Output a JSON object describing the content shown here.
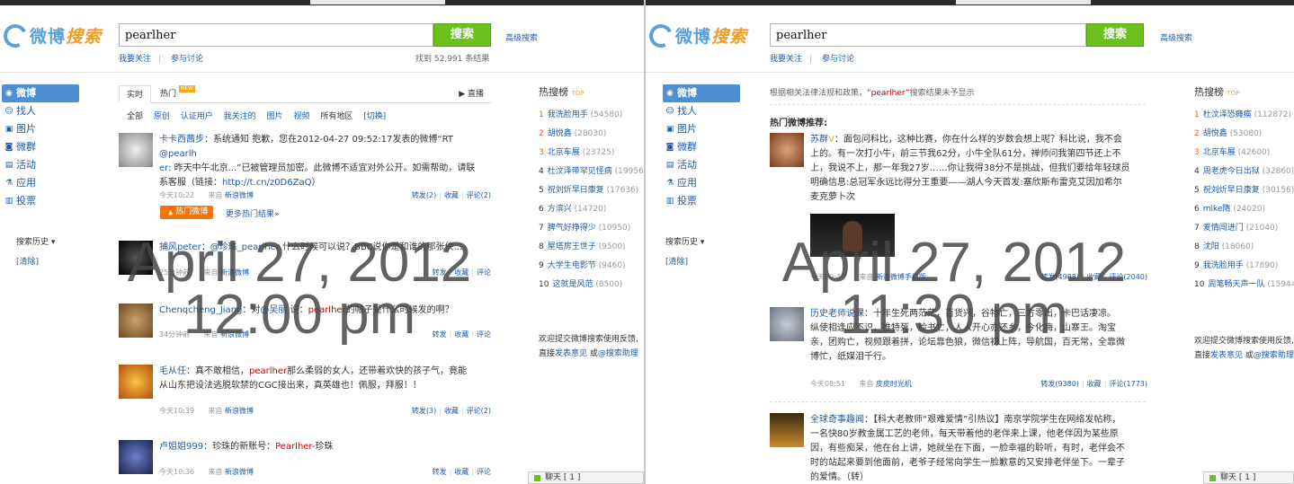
{
  "brand": {
    "logo_main": "微博",
    "logo_accent": "搜索"
  },
  "search": {
    "query": "pearlher",
    "button": "搜索",
    "advanced": "高级搜索",
    "follow": "我要关注",
    "discuss": "参与讨论"
  },
  "sidebar": {
    "items": [
      {
        "label": "微博",
        "icon": "weibo-icon"
      },
      {
        "label": "找人",
        "icon": "person-icon"
      },
      {
        "label": "图片",
        "icon": "image-icon"
      },
      {
        "label": "微群",
        "icon": "group-icon"
      },
      {
        "label": "活动",
        "icon": "event-icon"
      },
      {
        "label": "应用",
        "icon": "app-icon"
      },
      {
        "label": "投票",
        "icon": "vote-icon"
      }
    ],
    "history": "搜索历史 ▾",
    "clear": "[清除]"
  },
  "hot_rank": {
    "title": "热搜榜",
    "title_tag": "TOP"
  },
  "feedback": {
    "line1": "欢迎提交微博搜索使用反馈,",
    "line2_prefix": "直接",
    "line2_link1": "发表意见",
    "line2_mid": " 或",
    "line2_link2": "@搜索助理"
  },
  "chat": "聊天 [ 1 ]",
  "left": {
    "result_count": "找到 52,991 条结果",
    "tabs": {
      "realtime": "实时",
      "hot": "热门",
      "hot_badge": "NEW",
      "live": "直播"
    },
    "filters": [
      "全部",
      "原创",
      "认证用户",
      "我关注的",
      "图片",
      "视频",
      "所有地区",
      "[切换]"
    ],
    "feed": [
      {
        "user": "卡卡西茜步",
        "text1": "：系统通知 抱歉，您在2012-04-27 09:52:17发表的微博“RT ",
        "mention": "@pearlh",
        "text2": "er",
        "text3": ": 昨天中午北京...”已被管理员加密。此微博不适宜对外公开。如需帮助，请联",
        "text4": "系客服（链接：",
        "link": "http://t.cn/z0D6ZaQ",
        "text5": "）",
        "time": "今天10:22",
        "source_prefix": "来自 ",
        "source": "新浪微博",
        "acts": [
          "转发(2)",
          "收藏",
          "评论(2)"
        ]
      },
      {
        "user": "捕风peter",
        "text1": "：",
        "mention": "@珍珠_pearlher",
        "text2": " 什么时候可以说？BBC说你是和谁的那张侠...",
        "time": "25分钟前",
        "source_prefix": "来自 ",
        "source": "新浪微博",
        "acts": [
          "转发",
          "收藏",
          "评论"
        ]
      },
      {
        "user": "Chenqcheng_Jiang",
        "text1": "：对",
        "mention": "@吴丽",
        "text2": " 说：",
        "kw": "pearlher",
        "text3": "的帖子是什么时候发的啊？",
        "time": "34分钟前",
        "source_prefix": "来自 ",
        "source": "新浪微博",
        "acts": [
          "转发",
          "收藏",
          "评论"
        ]
      },
      {
        "user": "毛从任",
        "text1": "：真不敢相信，",
        "kw": "pearlher",
        "text2": "那么柔弱的女人，还带着欢快的孩子气，竟能",
        "text3": "从山东把设法逃脱软禁的CGC接出来，真英雄也！佩服，拜服！！",
        "time": "今天10:39",
        "source_prefix": "来自 ",
        "source": "新浪微博",
        "acts": [
          "转发(3)",
          "收藏",
          "评论(2)"
        ]
      },
      {
        "user": "卢姐姐999",
        "text1": "：珍珠的新账号：",
        "kw": "Pearlher",
        "text2": "-珍珠",
        "time": "今天10:36",
        "source_prefix": "来自 ",
        "source": "新浪微博",
        "acts": [
          "转发",
          "收藏",
          "评论"
        ]
      }
    ],
    "hot_button": "热门微博",
    "more_hot": "更多热门结果»",
    "rank": [
      {
        "n": "1",
        "name": "我洗脸用手",
        "count": "(54580)"
      },
      {
        "n": "2",
        "name": "胡悦鑫",
        "count": "(28030)"
      },
      {
        "n": "3",
        "name": "北京车展",
        "count": "(23725)"
      },
      {
        "n": "4",
        "name": "杜汶泽带罕见怪病",
        "count": "(19956)"
      },
      {
        "n": "5",
        "name": "祝刘炘早日康复",
        "count": "(17636)"
      },
      {
        "n": "6",
        "name": "方滨兴",
        "count": "(14720)"
      },
      {
        "n": "7",
        "name": "脾气好挣得少",
        "count": "(10950)"
      },
      {
        "n": "8",
        "name": "屋塔房王世子",
        "count": "(9500)"
      },
      {
        "n": "9",
        "name": "大学生电影节",
        "count": "(9460)"
      },
      {
        "n": "10",
        "name": "这就是风范",
        "count": "(8500)"
      }
    ],
    "overlay1": "April 27, 2012",
    "overlay2": "12:00 pm"
  },
  "right": {
    "notice_prefix": "根据相关法律法规和政策，",
    "notice_kw": "“pearlher”",
    "notice_suffix": "搜索结果未予显示",
    "section": "热门微博推荐:",
    "feed": [
      {
        "user": "苏群",
        "text1": "：面包问科比，这种比赛，你在什么样的岁数会想上呢？科比说，我不会",
        "text2": "上的。有一次打小牛，前三节我62分，小牛全队61分，禅师问我第四节还上不",
        "text3": "上，我说不上，那一年我27岁……你让我得38分不是挑战，但我们要给年轻球员",
        "text4": "明确信息:总冠军永远比得分王重要——湖人今天首发:塞欣斯布雷克艾因加希尔",
        "text5": "麦克萝卜次",
        "time": "今天09:47",
        "source_prefix": "来自 ",
        "source": "新浪微博手机版",
        "acts": [
          "转发(4988)",
          "收藏",
          "评论(2040)"
        ]
      },
      {
        "user": "历史老师说课",
        "text1": "：十年生死两茫茫，百货兴，谷物亡，三方零出，卡巴话凄凉。",
        "text2": "纵使相逢应不识，推特死，脸书亡，人人开心亦还乡，今化嗨，山寨王。淘宝",
        "text3": "亲，团购亡，视频跟着拼，论坛靠色狼，微信初上阵，导航国，百无常，全靠微",
        "text4": "博忙，纸媒泪千行。",
        "time": "今天08:51",
        "source_prefix": "来自 ",
        "source": "皮皮时光机",
        "acts": [
          "转发(9380)",
          "收藏",
          "评论(1773)"
        ]
      },
      {
        "user": "全球奇事趣闻",
        "text1": "：【科大老教师“艰难爱情”引热议】南京学院学生在网络发帖称，",
        "text2": "一名快80岁教金属工艺的老师，每天带着他的老伴来上课，他老伴因为某些原",
        "text3": "因，有些痴呆，他在台上讲，她就坐在下面，一脸幸福的聆听，有时，老伴会不",
        "text4": "时的站起来要到他面前，老爷子经常向学生一脸歉意的又安排老伴坐下。一辈子",
        "text5": "的爱情。（转）"
      }
    ],
    "rank": [
      {
        "n": "1",
        "name": "杜汶泽恐瘫痪",
        "count": "(112872)"
      },
      {
        "n": "2",
        "name": "胡悦鑫",
        "count": "(53080)"
      },
      {
        "n": "3",
        "name": "北京车展",
        "count": "(42600)"
      },
      {
        "n": "4",
        "name": "周老虎今日出狱",
        "count": "(32860)"
      },
      {
        "n": "5",
        "name": "祝刘炘早日康复",
        "count": "(30156)"
      },
      {
        "n": "6",
        "name": "mike隋",
        "count": "(24020)"
      },
      {
        "n": "7",
        "name": "爱情闯进门",
        "count": "(21040)"
      },
      {
        "n": "8",
        "name": "沈阳",
        "count": "(18060)"
      },
      {
        "n": "9",
        "name": "我洗脸用手",
        "count": "(17890)"
      },
      {
        "n": "10",
        "name": "周笔畅天声一队",
        "count": "(15944)"
      }
    ],
    "overlay1": "April 27, 2012",
    "overlay2": "11:30 pm"
  }
}
